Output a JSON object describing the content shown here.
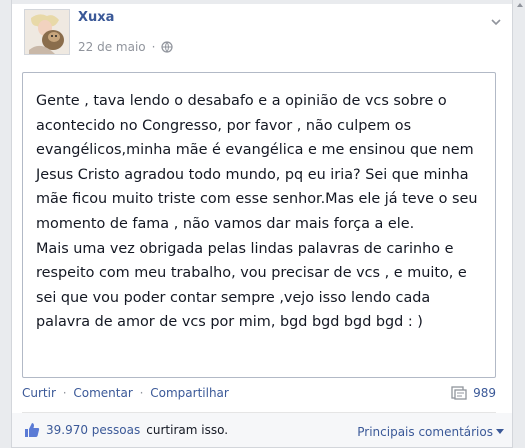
{
  "post": {
    "author": "Xuxa",
    "date": "22 de maio",
    "paragraphs": [
      "Gente , tava lendo o desabafo e a opinião de vcs sobre o acontecido no Congresso, por favor , não culpem os evangélicos,minha mãe é evangélica e me ensinou que nem Jesus Cristo agradou todo mundo, pq eu iria? Sei que minha mãe ficou muito triste com esse senhor.Mas ele já teve o seu momento de fama , não vamos dar mais força a ele.",
      "Mais uma vez obrigada pelas lindas palavras de carinho e respeito com meu trabalho, vou precisar de vcs , e muito, e sei que vou poder contar sempre ,vejo isso lendo cada palavra de amor de vcs por mim, bgd bgd bgd bgd : )"
    ]
  },
  "actions": {
    "like": "Curtir",
    "comment": "Comentar",
    "share": "Compartilhar",
    "separator": "·",
    "share_count": "989"
  },
  "footer": {
    "like_count": "39.970 pessoas",
    "like_suffix": "curtiram isso.",
    "sort_label": "Principais comentários"
  },
  "colors": {
    "link": "#3b5998",
    "muted": "#90949c",
    "text": "#141823"
  },
  "icons": {
    "privacy": "globe-icon",
    "menu": "chevron-down-icon",
    "share": "share-count-icon",
    "like": "thumbs-up-icon",
    "sort": "caret-down-icon"
  }
}
